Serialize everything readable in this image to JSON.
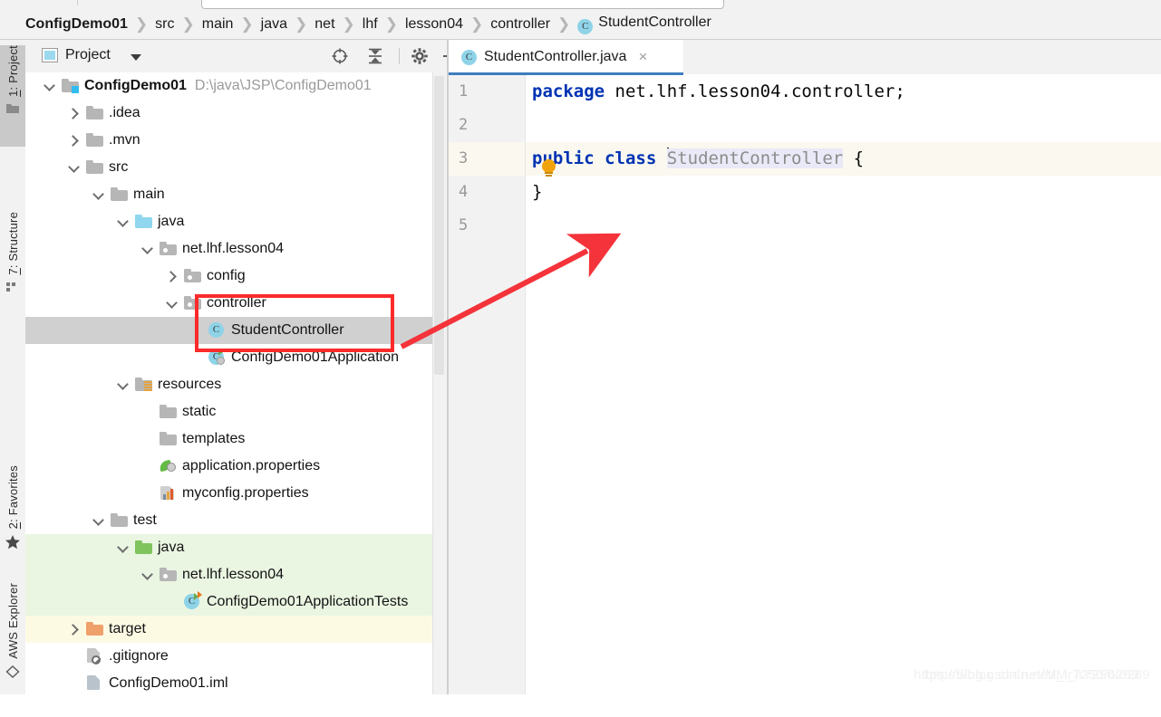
{
  "breadcrumb": {
    "items": [
      {
        "label": "ConfigDemo01",
        "bold": true,
        "icon": null
      },
      {
        "label": "src",
        "bold": false,
        "icon": null
      },
      {
        "label": "main",
        "bold": false,
        "icon": null
      },
      {
        "label": "java",
        "bold": false,
        "icon": null
      },
      {
        "label": "net",
        "bold": false,
        "icon": null
      },
      {
        "label": "lhf",
        "bold": false,
        "icon": null
      },
      {
        "label": "lesson04",
        "bold": false,
        "icon": null
      },
      {
        "label": "controller",
        "bold": false,
        "icon": null
      },
      {
        "label": "StudentController",
        "bold": false,
        "icon": "class-icon"
      }
    ],
    "separator": "❯",
    "class_icon_glyph": "C"
  },
  "toolstrip": {
    "buttons": [
      {
        "label": "1: Project",
        "active": true,
        "icon": "project-folder-icon"
      },
      {
        "label": "7: Structure",
        "active": false,
        "icon": "structure-icon"
      },
      {
        "label": "2: Favorites",
        "active": false,
        "icon": "star-icon"
      },
      {
        "label": "AWS Explorer",
        "active": false,
        "icon": "aws-icon"
      }
    ]
  },
  "project_panel": {
    "title": "Project",
    "dropdown_caret": "chevron-down-icon",
    "toolbar": [
      {
        "name": "locate-in-tree-icon",
        "tooltip": "Select Opened File"
      },
      {
        "name": "collapse-all-icon",
        "tooltip": "Collapse All"
      },
      {
        "name": "gear-icon",
        "tooltip": "Settings"
      },
      {
        "name": "minimize-icon",
        "tooltip": "Hide"
      }
    ],
    "tree": [
      {
        "label": "ConfigDemo01",
        "path": "D:\\java\\JSP\\ConfigDemo01",
        "depth": 0,
        "arrow": "down",
        "icon": "module-folder-icon",
        "bold": true,
        "highlight": "none"
      },
      {
        "label": ".idea",
        "path": "",
        "depth": 1,
        "arrow": "right",
        "icon": "folder-icon",
        "bold": false,
        "highlight": "none"
      },
      {
        "label": ".mvn",
        "path": "",
        "depth": 1,
        "arrow": "right",
        "icon": "folder-icon",
        "bold": false,
        "highlight": "none"
      },
      {
        "label": "src",
        "path": "",
        "depth": 1,
        "arrow": "down",
        "icon": "folder-icon",
        "bold": false,
        "highlight": "none"
      },
      {
        "label": "main",
        "path": "",
        "depth": 2,
        "arrow": "down",
        "icon": "folder-icon",
        "bold": false,
        "highlight": "none"
      },
      {
        "label": "java",
        "path": "",
        "depth": 3,
        "arrow": "down",
        "icon": "source-root-folder-icon",
        "bold": false,
        "highlight": "none"
      },
      {
        "label": "net.lhf.lesson04",
        "path": "",
        "depth": 4,
        "arrow": "down",
        "icon": "package-icon",
        "bold": false,
        "highlight": "none"
      },
      {
        "label": "config",
        "path": "",
        "depth": 5,
        "arrow": "right",
        "icon": "package-icon",
        "bold": false,
        "highlight": "none"
      },
      {
        "label": "controller",
        "path": "",
        "depth": 5,
        "arrow": "down",
        "icon": "package-icon",
        "bold": false,
        "highlight": "none"
      },
      {
        "label": "StudentController",
        "path": "",
        "depth": 6,
        "arrow": "none",
        "icon": "java-class-icon",
        "bold": false,
        "highlight": "selected"
      },
      {
        "label": "ConfigDemo01Application",
        "path": "",
        "depth": 6,
        "arrow": "none",
        "icon": "spring-boot-class-icon",
        "bold": false,
        "highlight": "none"
      },
      {
        "label": "resources",
        "path": "",
        "depth": 3,
        "arrow": "down",
        "icon": "resources-folder-icon",
        "bold": false,
        "highlight": "none"
      },
      {
        "label": "static",
        "path": "",
        "depth": 4,
        "arrow": "none",
        "icon": "folder-icon",
        "bold": false,
        "highlight": "none"
      },
      {
        "label": "templates",
        "path": "",
        "depth": 4,
        "arrow": "none",
        "icon": "folder-icon",
        "bold": false,
        "highlight": "none"
      },
      {
        "label": "application.properties",
        "path": "",
        "depth": 4,
        "arrow": "none",
        "icon": "spring-properties-icon",
        "bold": false,
        "highlight": "none"
      },
      {
        "label": "myconfig.properties",
        "path": "",
        "depth": 4,
        "arrow": "none",
        "icon": "properties-icon",
        "bold": false,
        "highlight": "none"
      },
      {
        "label": "test",
        "path": "",
        "depth": 2,
        "arrow": "down",
        "icon": "folder-icon",
        "bold": false,
        "highlight": "none"
      },
      {
        "label": "java",
        "path": "",
        "depth": 3,
        "arrow": "down",
        "icon": "test-source-root-folder-icon",
        "bold": false,
        "highlight": "green"
      },
      {
        "label": "net.lhf.lesson04",
        "path": "",
        "depth": 4,
        "arrow": "down",
        "icon": "package-icon",
        "bold": false,
        "highlight": "green"
      },
      {
        "label": "ConfigDemo01ApplicationTests",
        "path": "",
        "depth": 5,
        "arrow": "none",
        "icon": "spring-test-class-icon",
        "bold": false,
        "highlight": "green"
      },
      {
        "label": "target",
        "path": "",
        "depth": 1,
        "arrow": "right",
        "icon": "excluded-folder-icon",
        "bold": false,
        "highlight": "yellow"
      },
      {
        "label": ".gitignore",
        "path": "",
        "depth": 1,
        "arrow": "none",
        "icon": "gitignore-icon",
        "bold": false,
        "highlight": "none"
      },
      {
        "label": "ConfigDemo01.iml",
        "path": "",
        "depth": 1,
        "arrow": "none",
        "icon": "iml-file-icon",
        "bold": false,
        "highlight": "none"
      }
    ]
  },
  "editor": {
    "tab": {
      "label": "StudentController.java",
      "icon_glyph": "C",
      "close_glyph": "×"
    },
    "lines": [
      {
        "no": "1",
        "highlight": false,
        "tokens": [
          {
            "t": "package",
            "c": "k"
          },
          {
            "t": " net.lhf.lesson04.controller;",
            "c": "plain"
          }
        ]
      },
      {
        "no": "2",
        "highlight": false,
        "tokens": []
      },
      {
        "no": "3",
        "highlight": true,
        "tokens": [
          {
            "t": "public",
            "c": "k"
          },
          {
            "t": " ",
            "c": "plain"
          },
          {
            "t": "class",
            "c": "k"
          },
          {
            "t": " ",
            "c": "plain"
          },
          {
            "t": "StudentController",
            "c": "cname"
          },
          {
            "t": " {",
            "c": "plain"
          }
        ]
      },
      {
        "no": "4",
        "highlight": false,
        "tokens": [
          {
            "t": "}",
            "c": "plain"
          }
        ]
      },
      {
        "no": "5",
        "highlight": false,
        "tokens": []
      }
    ],
    "intention_bulb": "lightbulb-icon"
  },
  "annotations": {
    "highlight_box": {
      "label": "red-highlight-rectangle",
      "color": "#fc2b2b"
    },
    "arrow": {
      "label": "red-pointer-arrow",
      "color": "#f4333a"
    }
  },
  "watermark": {
    "text": "https://blog.csdn.net/M_lr7250/6289"
  },
  "colors": {
    "accent_blue": "#3d7dbf",
    "selection_grey": "#d0d0d0",
    "test_green": "#eaf5e2",
    "excluded_yellow": "#fdfae4",
    "annotation_red": "#fc2b2b",
    "keyword_blue": "#0033b3"
  }
}
